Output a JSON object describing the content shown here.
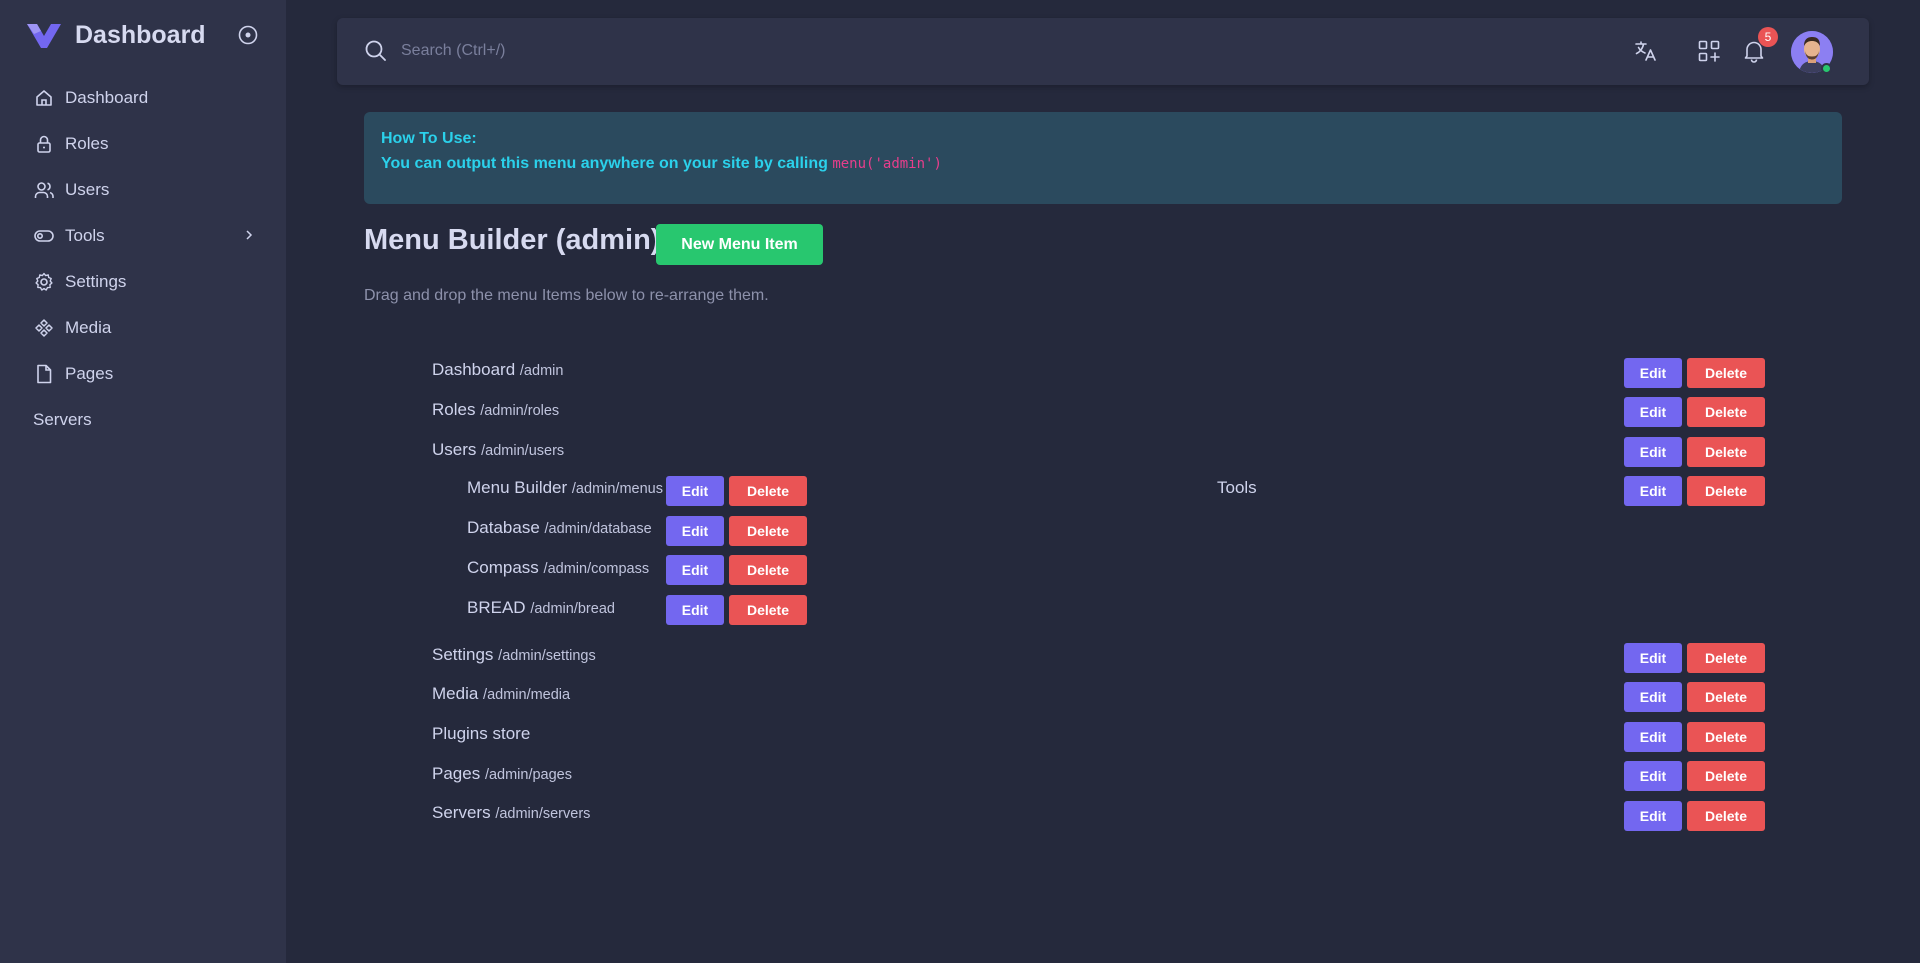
{
  "brand": {
    "name": "Dashboard",
    "accent": "#7367f0"
  },
  "sidebar": {
    "items": [
      {
        "label": "Dashboard",
        "icon": "home-icon"
      },
      {
        "label": "Roles",
        "icon": "lock-icon"
      },
      {
        "label": "Users",
        "icon": "users-icon"
      },
      {
        "label": "Tools",
        "icon": "toggle-icon",
        "has_children": true
      },
      {
        "label": "Settings",
        "icon": "gear-icon"
      },
      {
        "label": "Media",
        "icon": "media-icon"
      },
      {
        "label": "Pages",
        "icon": "file-icon"
      },
      {
        "label": "Servers",
        "icon": ""
      }
    ]
  },
  "topbar": {
    "search_placeholder": "Search (Ctrl+/)",
    "notification_count": "5"
  },
  "alert": {
    "title": "How To Use:",
    "text": "You can output this menu anywhere on your site by calling ",
    "code": "menu('admin')"
  },
  "page": {
    "title": "Menu Builder (admin)",
    "new_item_label": "New Menu Item",
    "subtitle": "Drag and drop the menu Items below to re-arrange them."
  },
  "buttons": {
    "edit": "Edit",
    "delete": "Delete"
  },
  "menu_items": [
    {
      "name": "Dashboard",
      "url": "/admin"
    },
    {
      "name": "Roles",
      "url": "/admin/roles"
    },
    {
      "name": "Users",
      "url": "/admin/users"
    },
    {
      "name": "Tools",
      "url": ""
    },
    {
      "name": "Settings",
      "url": "/admin/settings"
    },
    {
      "name": "Media",
      "url": "/admin/media"
    },
    {
      "name": "Plugins store",
      "url": ""
    },
    {
      "name": "Pages",
      "url": "/admin/pages"
    },
    {
      "name": "Servers",
      "url": "/admin/servers"
    }
  ],
  "tools_children": [
    {
      "name": "Menu Builder",
      "url": "/admin/menus"
    },
    {
      "name": "Database",
      "url": "/admin/database"
    },
    {
      "name": "Compass",
      "url": "/admin/compass"
    },
    {
      "name": "BREAD",
      "url": "/admin/bread"
    }
  ],
  "colors": {
    "edit": "#7367f0",
    "delete": "#ea5455",
    "new": "#28c76f",
    "info": "#2bd1eb"
  }
}
